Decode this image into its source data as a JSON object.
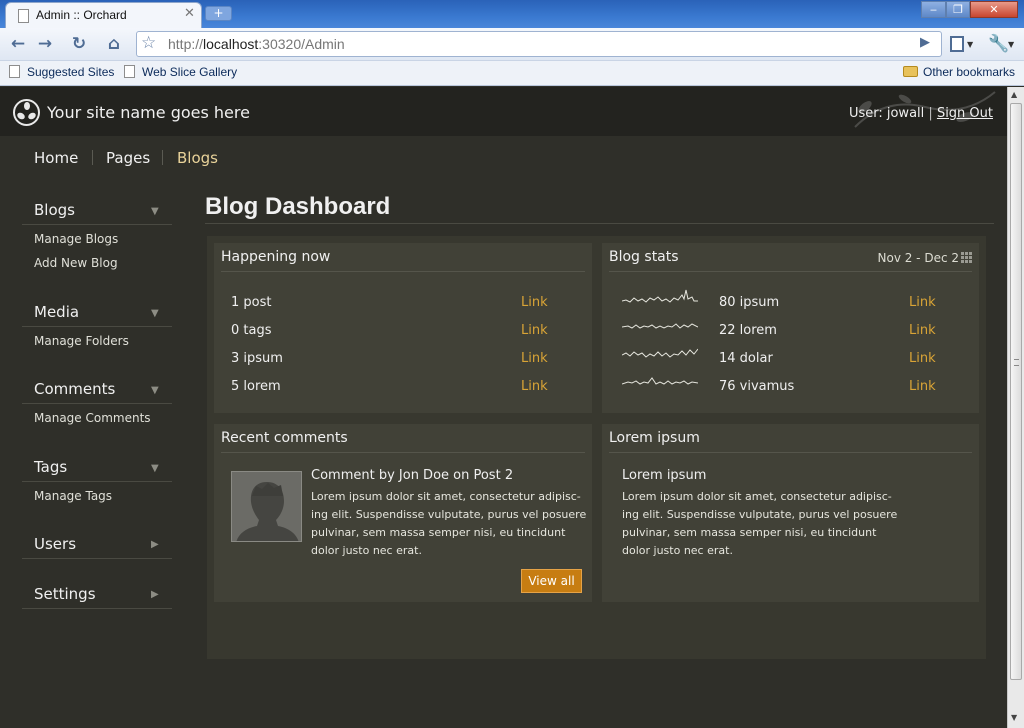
{
  "browser": {
    "tab_title": "Admin :: Orchard",
    "url_prefix": "http://",
    "url_host": "localhost",
    "url_rest": ":30320/Admin",
    "bookmarks": [
      "Suggested Sites",
      "Web Slice Gallery"
    ],
    "other_bookmarks": "Other bookmarks"
  },
  "site": {
    "name": "Your site name goes here",
    "user_label": "User: jowall",
    "separator": "|",
    "sign_out": "Sign Out"
  },
  "topnav": [
    "Home",
    "Pages",
    "Blogs"
  ],
  "sidebar": {
    "sections": [
      {
        "title": "Blogs",
        "links": [
          "Manage Blogs",
          "Add New Blog"
        ]
      },
      {
        "title": "Media",
        "links": [
          "Manage Folders"
        ]
      },
      {
        "title": "Comments",
        "links": [
          "Manage Comments"
        ]
      },
      {
        "title": "Tags",
        "links": [
          "Manage Tags"
        ]
      },
      {
        "title": "Users",
        "links": []
      },
      {
        "title": "Settings",
        "links": []
      }
    ]
  },
  "main": {
    "title": "Blog Dashboard",
    "happening": {
      "title": "Happening now",
      "rows": [
        {
          "label": "1 post",
          "link": "Link"
        },
        {
          "label": "0 tags",
          "link": "Link"
        },
        {
          "label": "3 ipsum",
          "link": "Link"
        },
        {
          "label": "5 lorem",
          "link": "Link"
        }
      ]
    },
    "stats": {
      "title": "Blog stats",
      "date_range": "Nov 2 - Dec 2",
      "rows": [
        {
          "label": "80 ipsum",
          "link": "Link"
        },
        {
          "label": "22 lorem",
          "link": "Link"
        },
        {
          "label": "14 dolar",
          "link": "Link"
        },
        {
          "label": "76 vivamus",
          "link": "Link"
        }
      ]
    },
    "comments": {
      "title": "Recent comments",
      "heading": "Comment by Jon Doe on Post 2",
      "body_lines": [
        "Lorem ipsum dolor sit amet, consectetur adipisc-",
        "ing elit. Suspendisse vulputate, purus vel posuere",
        "pulvinar, sem massa semper nisi, eu tincidunt",
        "dolor justo nec erat."
      ],
      "button": "View all"
    },
    "lorem": {
      "title": "Lorem ipsum",
      "heading": "Lorem ipsum",
      "body_lines": [
        "Lorem ipsum dolor sit amet, consectetur adipisc-",
        "ing elit. Suspendisse vulputate, purus vel posuere",
        "pulvinar, sem massa semper nisi, eu tincidunt",
        "dolor justo nec erat."
      ]
    }
  }
}
